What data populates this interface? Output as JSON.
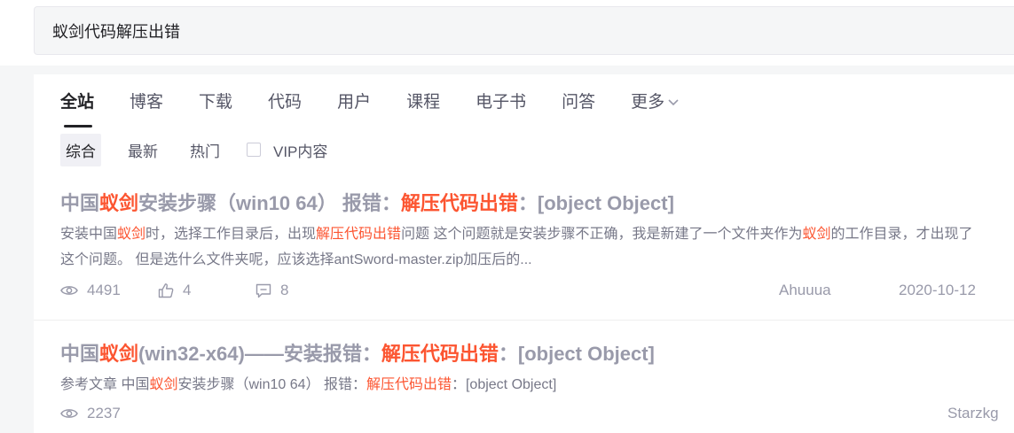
{
  "search": {
    "query": "蚁剑代码解压出错"
  },
  "tabs": [
    {
      "label": "全站"
    },
    {
      "label": "博客"
    },
    {
      "label": "下载"
    },
    {
      "label": "代码"
    },
    {
      "label": "用户"
    },
    {
      "label": "课程"
    },
    {
      "label": "电子书"
    },
    {
      "label": "问答"
    },
    {
      "label": "更多"
    }
  ],
  "filters": {
    "comprehensive": "综合",
    "latest": "最新",
    "hot": "热门",
    "vip": "VIP内容"
  },
  "colors": {
    "highlight": "#fc5531",
    "title_gray": "#999aaa"
  },
  "results": [
    {
      "title_parts": [
        "中国",
        "蚁剑",
        "安装步骤（win10 64） 报错：",
        "解压代码出错",
        "：[object Object]"
      ],
      "desc_parts": [
        "安装中国",
        "蚁剑",
        "时，选择工作目录后，出现",
        "解压代码出错",
        "问题 这个问题就是安装步骤不正确，我是新建了一个文件夹作为",
        "蚁剑",
        "的工作目录，才出现了这个问题。 但是选什么文件夹呢，应该选择antSword-master.zip加压后的..."
      ],
      "views": "4491",
      "likes": "4",
      "comments": "8",
      "author": "Ahuuua",
      "date": "2020-10-12"
    },
    {
      "title_parts": [
        "中国",
        "蚁剑",
        "(win32-x64)——安装报错：",
        "解压代码出错",
        "：[object Object]"
      ],
      "desc_parts": [
        "参考文章 中国",
        "蚁剑",
        "安装步骤（win10 64） 报错：",
        "解压代码出错",
        "：[object Object]"
      ],
      "views": "2237",
      "author": "Starzkg"
    }
  ]
}
